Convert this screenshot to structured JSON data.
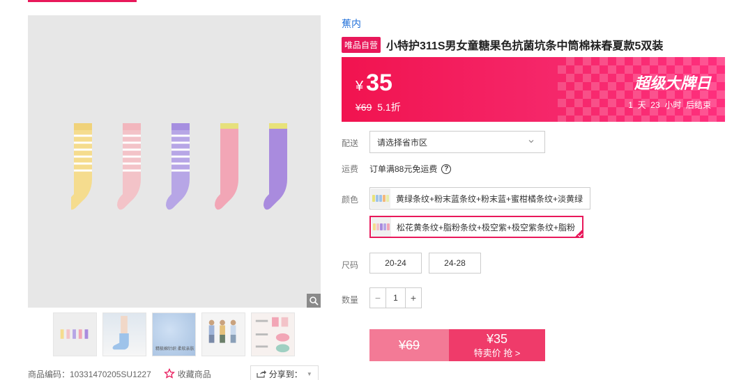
{
  "product": {
    "brand": "蕉内",
    "badge": "唯品自营",
    "title": "小特护311S男女童糖果色抗菌坑条中筒棉袜春夏款5双装",
    "code_label": "商品编码：10331470205SU1227",
    "favorite_label": "收藏商品",
    "share_label": "分享到："
  },
  "price": {
    "currency": "¥",
    "current": "35",
    "original": "¥69",
    "discount": "5.1折",
    "event_title": "超级大牌日",
    "countdown": "1  天  23  小时  后结束"
  },
  "labels": {
    "delivery": "配送",
    "shipping": "运费",
    "color": "颜色",
    "size": "尺码",
    "quantity": "数量"
  },
  "delivery": {
    "placeholder": "请选择省市区"
  },
  "shipping": {
    "text": "订单满88元免运费",
    "help": "?"
  },
  "colors": [
    {
      "label": "黄绿条纹+粉末蓝条纹+粉末蓝+蜜柑橘条纹+淡黄绿",
      "selected": false
    },
    {
      "label": "松花黄条纹+脂粉条纹+极空紫+极空紫条纹+脂粉",
      "selected": true
    }
  ],
  "sizes": [
    "20-24",
    "24-28"
  ],
  "quantity": {
    "value": "1",
    "minus": "−",
    "plus": "+"
  },
  "buy": {
    "original_price": "¥69",
    "sale_price": "¥35",
    "sale_label": "特卖价 抢 >"
  },
  "thumbnails": [
    {
      "name": "thumb-socks-set"
    },
    {
      "name": "thumb-socks-on-feet"
    },
    {
      "name": "thumb-fabric-closeup",
      "caption": "精梳棉针织 柔软亲肤"
    },
    {
      "name": "thumb-kids-models"
    },
    {
      "name": "thumb-detail-features"
    }
  ],
  "colors_theme": {
    "accent": "#e8185a",
    "brand_blue": "#1f6fd9"
  }
}
